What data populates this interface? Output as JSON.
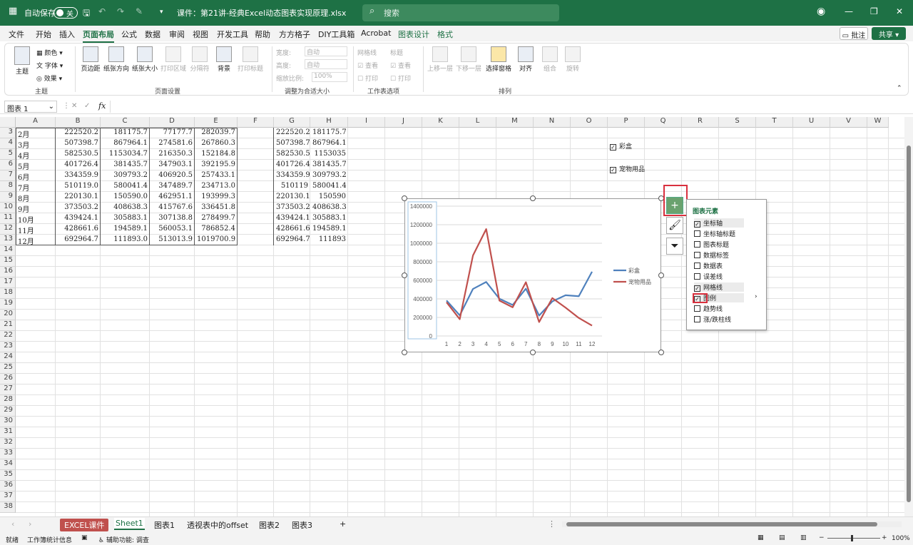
{
  "titlebar": {
    "app_icon": "excel-icon",
    "autosave_label": "自动保存",
    "autosave_state": "关",
    "doc_title": "课件：第21讲-经典Excel动态图表实现原理.xlsx",
    "search_placeholder": "搜索"
  },
  "menu": {
    "tabs": [
      "文件",
      "开始",
      "插入",
      "页面布局",
      "公式",
      "数据",
      "审阅",
      "视图",
      "开发工具",
      "帮助",
      "方方格子",
      "DIY工具箱",
      "Acrobat",
      "图表设计",
      "格式"
    ],
    "active": "页面布局",
    "comment_label": "批注",
    "share_label": "共享"
  },
  "ribbon": {
    "theme": {
      "theme_label": "主题",
      "colors_label": "颜色",
      "fonts_label": "字体",
      "effects_label": "效果",
      "group": "主题"
    },
    "page_setup": {
      "margins": "页边距",
      "orientation": "纸张方向",
      "size": "纸张大小",
      "print_area": "打印区域",
      "breaks": "分隔符",
      "background": "背景",
      "print_titles": "打印标题",
      "group": "页面设置"
    },
    "scale": {
      "width_label": "宽度:",
      "width_value": "自动",
      "height_label": "高度:",
      "height_value": "自动",
      "scale_label": "缩放比例:",
      "scale_value": "100%",
      "group": "调整为合适大小"
    },
    "sheet_opts": {
      "gridlines": "网格线",
      "headings": "标题",
      "view": "查看",
      "print": "打印",
      "group": "工作表选项"
    },
    "arrange": {
      "forward": "上移一层",
      "backward": "下移一层",
      "selection": "选择窗格",
      "align": "对齐",
      "group_btn": "组合",
      "rotate": "旋转",
      "group": "排列"
    }
  },
  "formula_bar": {
    "name_box": "图表 1",
    "fx": "fx",
    "value": ""
  },
  "columns": [
    "A",
    "B",
    "C",
    "D",
    "E",
    "F",
    "G",
    "H",
    "I",
    "J",
    "K",
    "L",
    "M",
    "N",
    "O",
    "P",
    "Q",
    "R",
    "S",
    "T",
    "U",
    "V",
    "W"
  ],
  "rows": [
    3,
    4,
    5,
    6,
    7,
    8,
    9,
    10,
    11,
    12,
    13,
    14,
    15,
    16,
    17,
    18,
    19,
    20,
    21,
    22,
    23,
    24,
    25,
    26,
    27,
    28,
    29,
    30,
    31,
    32,
    33,
    34,
    35,
    36,
    37,
    38
  ],
  "table": [
    [
      "2月",
      "222520.2",
      "181175.7",
      "77177.7",
      "282039.7",
      "",
      "222520.2",
      "181175.7"
    ],
    [
      "3月",
      "507398.7",
      "867964.1",
      "274581.6",
      "267860.3",
      "",
      "507398.7",
      "867964.1"
    ],
    [
      "4月",
      "582530.5",
      "1153034.7",
      "216350.3",
      "152184.8",
      "",
      "582530.5",
      "1153035"
    ],
    [
      "5月",
      "401726.4",
      "381435.7",
      "347903.1",
      "392195.9",
      "",
      "401726.4",
      "381435.7"
    ],
    [
      "6月",
      "334359.9",
      "309793.2",
      "406920.5",
      "257433.1",
      "",
      "334359.9",
      "309793.2"
    ],
    [
      "7月",
      "510119.0",
      "580041.4",
      "347489.7",
      "234713.0",
      "",
      "510119",
      "580041.4"
    ],
    [
      "8月",
      "220130.1",
      "150590.0",
      "462951.1",
      "193999.3",
      "",
      "220130.1",
      "150590"
    ],
    [
      "9月",
      "373503.2",
      "408638.3",
      "415767.6",
      "336451.8",
      "",
      "373503.2",
      "408638.3"
    ],
    [
      "10月",
      "439424.1",
      "305883.1",
      "307138.8",
      "278499.7",
      "",
      "439424.1",
      "305883.1"
    ],
    [
      "11月",
      "428661.6",
      "194589.1",
      "560053.1",
      "786852.4",
      "",
      "428661.6",
      "194589.1"
    ],
    [
      "12月",
      "692964.7",
      "111893.0",
      "513013.9",
      "1019700.9",
      "",
      "692964.7",
      "111893"
    ]
  ],
  "checkboxes": [
    {
      "label": "彩盒",
      "checked": true
    },
    {
      "label": "宠物用品",
      "checked": true
    }
  ],
  "chart_data": {
    "type": "line",
    "x": [
      1,
      2,
      3,
      4,
      5,
      6,
      7,
      8,
      9,
      10,
      11,
      12
    ],
    "ylim": [
      0,
      1400000
    ],
    "yticks": [
      "0",
      "200000",
      "400000",
      "600000",
      "800000",
      "1000000",
      "1200000",
      "1400000"
    ],
    "grid": true,
    "legend": "right",
    "series": [
      {
        "name": "彩盒",
        "color": "#4f81bd",
        "values": [
          383000,
          222520.2,
          507398.7,
          582530.5,
          401726.4,
          334359.9,
          510119,
          220130.1,
          373503.2,
          439424.1,
          428661.6,
          692964.7
        ]
      },
      {
        "name": "宠物用品",
        "color": "#c0504d",
        "values": [
          364000,
          181175.7,
          867964.1,
          1153035,
          381435.7,
          309793.2,
          580041.4,
          150590,
          408638.3,
          305883.1,
          194589.1,
          111893
        ]
      }
    ]
  },
  "chart_elements": {
    "title": "图表元素",
    "items": [
      {
        "label": "坐标轴",
        "checked": true
      },
      {
        "label": "坐标轴标题",
        "checked": false
      },
      {
        "label": "图表标题",
        "checked": false
      },
      {
        "label": "数据标签",
        "checked": false
      },
      {
        "label": "数据表",
        "checked": false
      },
      {
        "label": "误差线",
        "checked": false
      },
      {
        "label": "网格线",
        "checked": true
      },
      {
        "label": "图例",
        "checked": true
      },
      {
        "label": "趋势线",
        "checked": false
      },
      {
        "label": "涨/跌柱线",
        "checked": false
      }
    ]
  },
  "sheet_tabs": {
    "tabs": [
      "EXCEL课件",
      "Sheet1",
      "图表1",
      "透视表中的offset",
      "图表2",
      "图表3"
    ],
    "active": "Sheet1",
    "highlight": "EXCEL课件",
    "highlight_color": "#c0504d",
    "add": "+"
  },
  "status": {
    "ready": "就绪",
    "stats": "工作簿统计信息",
    "accessibility": "辅助功能: 调查",
    "zoom": "100%"
  },
  "colors": {
    "accent": "#1e7145",
    "selection": "#d9303e"
  }
}
